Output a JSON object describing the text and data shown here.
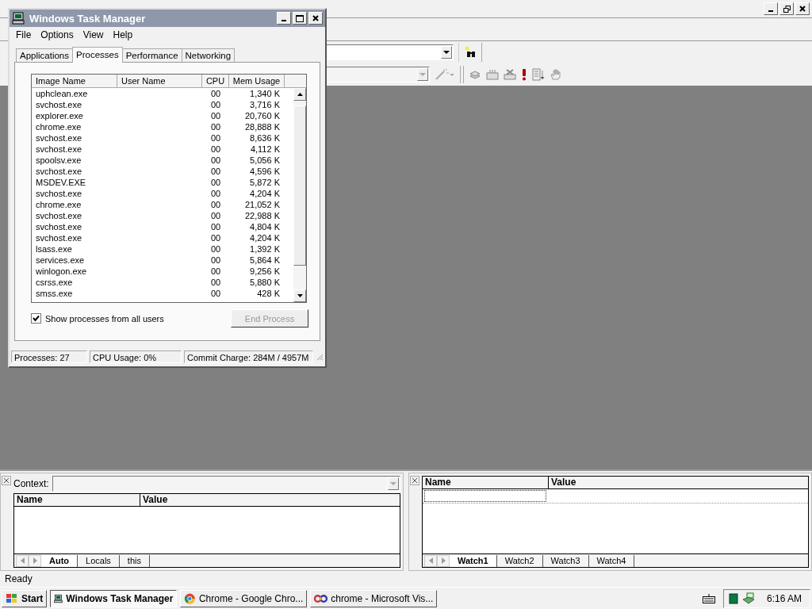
{
  "task_manager": {
    "title": "Windows Task Manager",
    "menu": [
      "File",
      "Options",
      "View",
      "Help"
    ],
    "tabs": [
      {
        "label": "Applications",
        "selected": false
      },
      {
        "label": "Processes",
        "selected": true
      },
      {
        "label": "Performance",
        "selected": false
      },
      {
        "label": "Networking",
        "selected": false
      }
    ],
    "columns": [
      "Image Name",
      "User Name",
      "CPU",
      "Mem Usage"
    ],
    "processes": [
      {
        "image_name": "uphclean.exe",
        "cpu": "00",
        "mem_usage": "1,340 K"
      },
      {
        "image_name": "svchost.exe",
        "cpu": "00",
        "mem_usage": "3,716 K"
      },
      {
        "image_name": "explorer.exe",
        "cpu": "00",
        "mem_usage": "20,760 K"
      },
      {
        "image_name": "chrome.exe",
        "cpu": "00",
        "mem_usage": "28,888 K"
      },
      {
        "image_name": "svchost.exe",
        "cpu": "00",
        "mem_usage": "8,636 K"
      },
      {
        "image_name": "svchost.exe",
        "cpu": "00",
        "mem_usage": "4,112 K"
      },
      {
        "image_name": "spoolsv.exe",
        "cpu": "00",
        "mem_usage": "5,056 K"
      },
      {
        "image_name": "svchost.exe",
        "cpu": "00",
        "mem_usage": "4,596 K"
      },
      {
        "image_name": "MSDEV.EXE",
        "cpu": "00",
        "mem_usage": "5,872 K"
      },
      {
        "image_name": "svchost.exe",
        "cpu": "00",
        "mem_usage": "4,204 K"
      },
      {
        "image_name": "chrome.exe",
        "cpu": "00",
        "mem_usage": "21,052 K"
      },
      {
        "image_name": "svchost.exe",
        "cpu": "00",
        "mem_usage": "22,988 K"
      },
      {
        "image_name": "svchost.exe",
        "cpu": "00",
        "mem_usage": "4,804 K"
      },
      {
        "image_name": "svchost.exe",
        "cpu": "00",
        "mem_usage": "4,204 K"
      },
      {
        "image_name": "lsass.exe",
        "cpu": "00",
        "mem_usage": "1,392 K"
      },
      {
        "image_name": "services.exe",
        "cpu": "00",
        "mem_usage": "5,864 K"
      },
      {
        "image_name": "winlogon.exe",
        "cpu": "00",
        "mem_usage": "9,256 K"
      },
      {
        "image_name": "csrss.exe",
        "cpu": "00",
        "mem_usage": "5,880 K"
      },
      {
        "image_name": "smss.exe",
        "cpu": "00",
        "mem_usage": "428 K"
      }
    ],
    "show_all_users": {
      "label": "Show processes from all users",
      "checked": true
    },
    "end_process": {
      "label": "End Process",
      "disabled": true
    },
    "status": [
      "Processes: 27",
      "CPU Usage: 0%",
      "Commit Charge: 284M / 4957M"
    ]
  },
  "variables_pane": {
    "context_label": "Context:",
    "columns": [
      "Name",
      "Value"
    ],
    "tabs": [
      {
        "label": "Auto",
        "selected": true
      },
      {
        "label": "Locals",
        "selected": false
      },
      {
        "label": "this",
        "selected": false
      }
    ]
  },
  "watch_pane": {
    "columns": [
      "Name",
      "Value"
    ],
    "tabs": [
      {
        "label": "Watch1",
        "selected": true
      },
      {
        "label": "Watch2",
        "selected": false
      },
      {
        "label": "Watch3",
        "selected": false
      },
      {
        "label": "Watch4",
        "selected": false
      }
    ]
  },
  "status_bar": "Ready",
  "taskbar": {
    "start": "Start",
    "tasks": [
      {
        "label": "Windows Task Manager",
        "kind": "taskmgr",
        "selected": true
      },
      {
        "label": "Chrome - Google Chro...",
        "kind": "chrome",
        "selected": false
      },
      {
        "label": "chrome - Microsoft Vis...",
        "kind": "devstudio",
        "selected": false
      }
    ],
    "clock": "6:16 AM"
  }
}
